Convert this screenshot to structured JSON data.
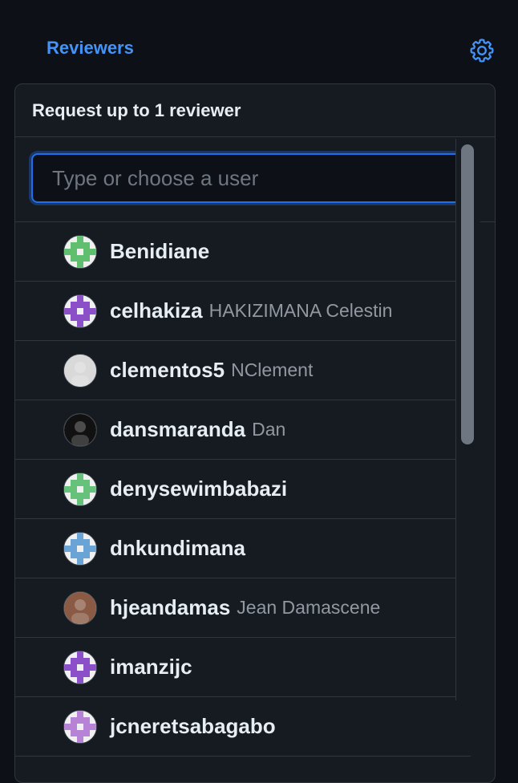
{
  "header": {
    "title": "Reviewers",
    "settings_icon": "gear-icon"
  },
  "panel": {
    "title": "Request up to 1 reviewer",
    "filter_placeholder": "Type or choose a user"
  },
  "colors": {
    "accent": "#4493f8",
    "background": "#0d1117",
    "panel": "#161b22",
    "border": "#30363d"
  },
  "users": [
    {
      "login": "Benidiane",
      "name": "",
      "avatar": "identicon",
      "avatar_color": "#5fbf6f"
    },
    {
      "login": "celhakiza",
      "name": "HAKIZIMANA Celestin",
      "avatar": "identicon",
      "avatar_color": "#8b4fc7"
    },
    {
      "login": "clementos5",
      "name": "NClement",
      "avatar": "photo",
      "avatar_color": "#d9d9d9"
    },
    {
      "login": "dansmaranda",
      "name": "Dan",
      "avatar": "photo",
      "avatar_color": "#111111"
    },
    {
      "login": "denysewimbabazi",
      "name": "",
      "avatar": "identicon",
      "avatar_color": "#66c27a"
    },
    {
      "login": "dnkundimana",
      "name": "",
      "avatar": "identicon",
      "avatar_color": "#6aa3d6"
    },
    {
      "login": "hjeandamas",
      "name": "Jean Damascene",
      "avatar": "photo",
      "avatar_color": "#8a5a44"
    },
    {
      "login": "imanzijc",
      "name": "",
      "avatar": "identicon",
      "avatar_color": "#8a4fc9"
    },
    {
      "login": "jcneretsabagabo",
      "name": "",
      "avatar": "identicon",
      "avatar_color": "#b783d6"
    }
  ]
}
